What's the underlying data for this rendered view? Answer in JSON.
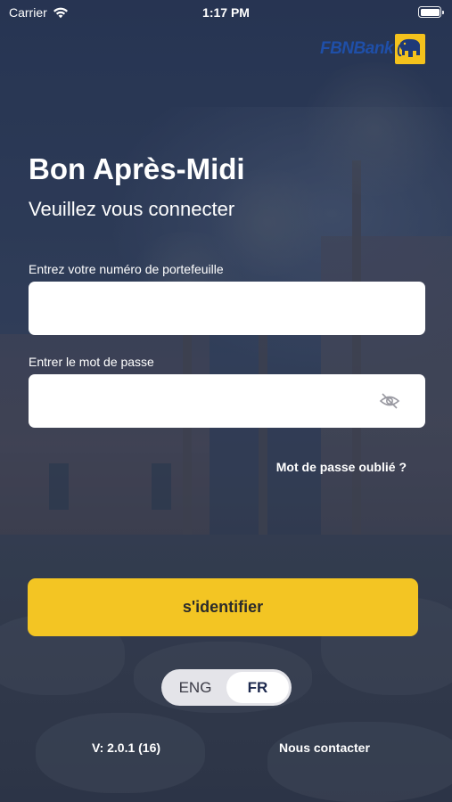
{
  "status_bar": {
    "carrier": "Carrier",
    "time": "1:17 PM"
  },
  "logo": {
    "text": "FBNBank",
    "text_color": "#1f4fa8",
    "mark_color": "#f4c21c"
  },
  "login": {
    "greeting": "Bon Après-Midi",
    "subtitle": "Veuillez vous connecter",
    "wallet_label": "Entrez votre numéro de portefeuille",
    "wallet_value": "",
    "password_label": "Entrer le mot de passe",
    "password_value": "",
    "password_visibility_icon": "eye-off-icon",
    "forgot_password": "Mot de passe oublié ?",
    "submit_label": "s'identifier",
    "submit_color": "#f3c523"
  },
  "language": {
    "options": [
      "ENG",
      "FR"
    ],
    "selected": "FR"
  },
  "footer": {
    "version": "V: 2.0.1 (16)",
    "contact": "Nous contacter"
  }
}
